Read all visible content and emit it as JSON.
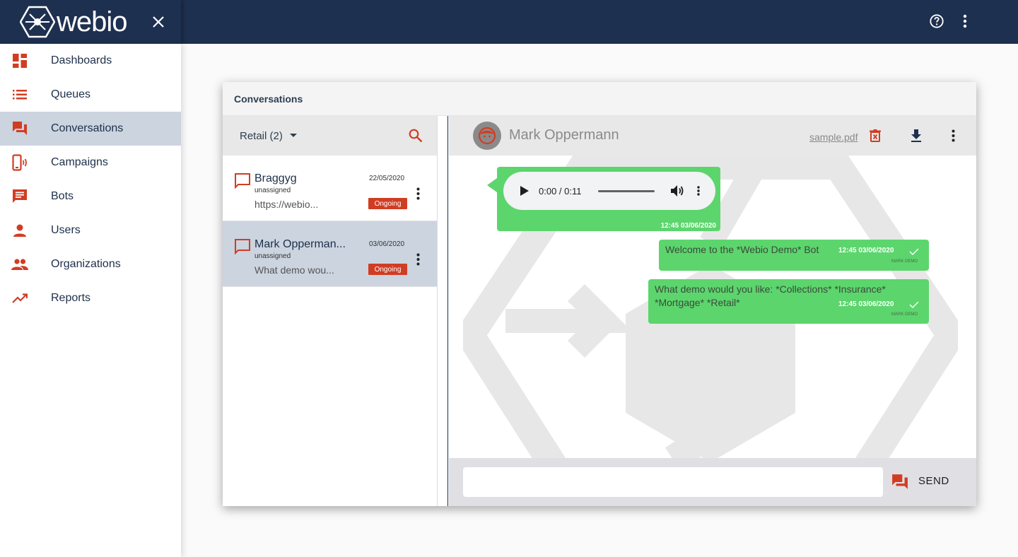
{
  "brand": {
    "name": "webio",
    "logo_icon": "hexagon-network-logo",
    "close_icon": "close-icon"
  },
  "topbar": {
    "help_icon": "help-circle-icon",
    "menu_icon": "more-vertical-icon"
  },
  "sidebar": {
    "items": [
      {
        "label": "Dashboards",
        "icon": "dashboard-icon",
        "active": false
      },
      {
        "label": "Queues",
        "icon": "list-icon",
        "active": false
      },
      {
        "label": "Conversations",
        "icon": "forum-icon",
        "active": true
      },
      {
        "label": "Campaigns",
        "icon": "phone-broadcast-icon",
        "active": false
      },
      {
        "label": "Bots",
        "icon": "chat-message-icon",
        "active": false
      },
      {
        "label": "Users",
        "icon": "person-icon",
        "active": false
      },
      {
        "label": "Organizations",
        "icon": "people-icon",
        "active": false
      },
      {
        "label": "Reports",
        "icon": "trending-up-icon",
        "active": false
      }
    ]
  },
  "panel": {
    "title": "Conversations"
  },
  "list": {
    "queue_label": "Retail (2)",
    "conversations": [
      {
        "name": "Braggyg",
        "assignee": "unassigned",
        "preview": "https://webio...",
        "date": "22/05/2020",
        "status": "Ongoing",
        "selected": false
      },
      {
        "name": "Mark Opperman...",
        "assignee": "unassigned",
        "preview": "What demo wou...",
        "date": "03/06/2020",
        "status": "Ongoing",
        "selected": true
      }
    ]
  },
  "chat": {
    "contact_name": "Mark Oppermann",
    "attachment": "sample.pdf",
    "messages": [
      {
        "type": "audio",
        "audio_time": "0:00 / 0:11",
        "time": "12:45 03/06/2020"
      },
      {
        "type": "text",
        "text": "Welcome to the *Webio Demo* Bot",
        "time": "12:45 03/06/2020",
        "sender": "MARK DEMO"
      },
      {
        "type": "text",
        "text_line1": "What demo would you like: *Collections* *Insurance*",
        "text_line2": "*Mortgage* *Retail*",
        "time": "12:45 03/06/2020",
        "sender": "MARK DEMO"
      }
    ]
  },
  "composer": {
    "placeholder": "",
    "send_label": "SEND"
  },
  "colors": {
    "navy": "#1e3050",
    "accent": "#d13d23",
    "bubble": "#5cd56d",
    "selected": "#cbd4df"
  }
}
